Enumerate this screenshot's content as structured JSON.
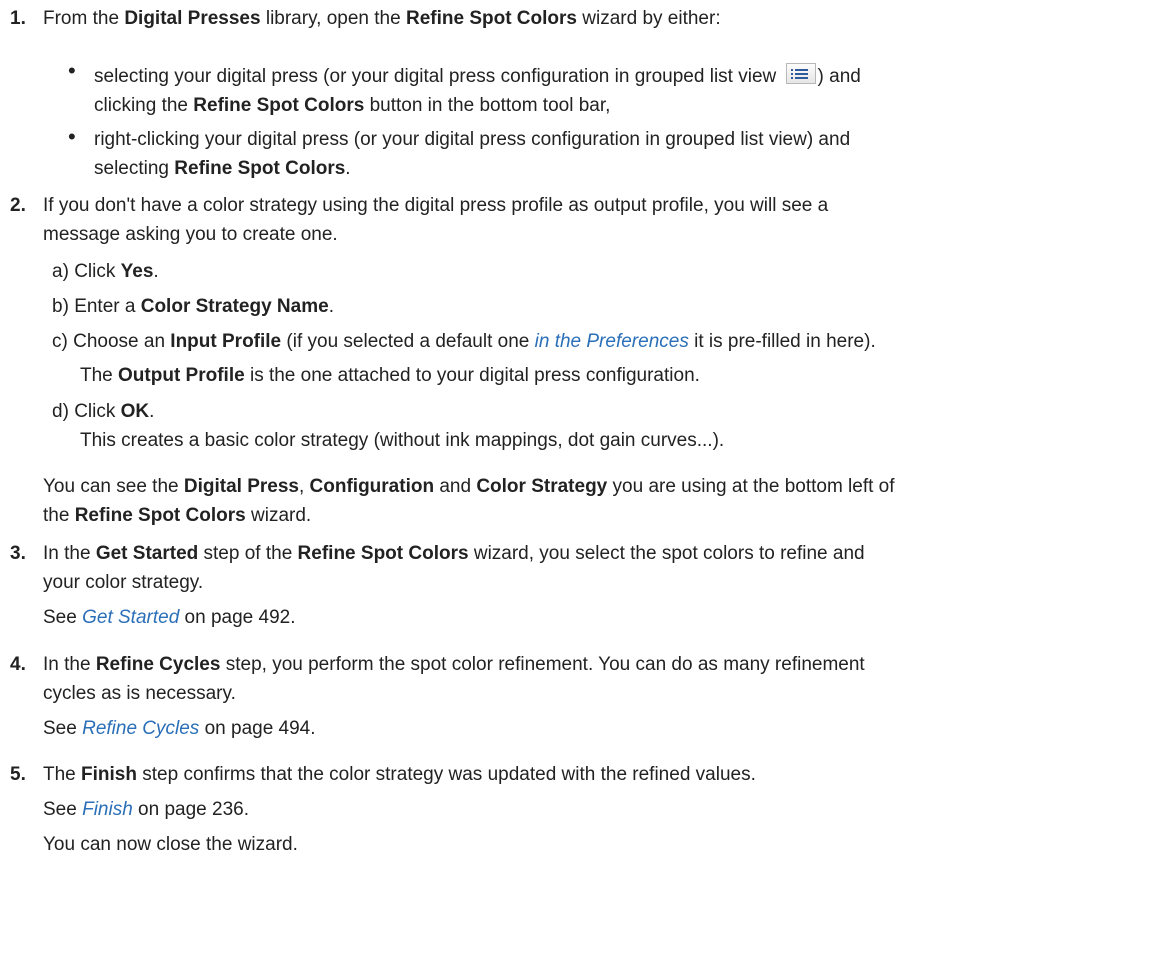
{
  "steps": [
    {
      "num": "1.",
      "line1": [
        "From the ",
        "Digital Presses",
        " library, open the ",
        "Refine Spot Colors",
        " wizard by either:"
      ],
      "bullets": [
        {
          "line1_a": "selecting your digital press (or your digital press configuration in grouped list view ",
          "line1_b": ") and",
          "line2": [
            "clicking the ",
            "Refine Spot Colors",
            " button in the bottom tool bar,"
          ]
        },
        {
          "line1": "right-clicking your digital press (or your digital press configuration in grouped list view) and",
          "line2": [
            "selecting ",
            "Refine Spot Colors",
            "."
          ]
        }
      ]
    },
    {
      "num": "2.",
      "line1": "If you don't have a color strategy using the digital press profile as output profile, you will see a",
      "line2": "message asking you to create one.",
      "sub": {
        "a": [
          "a)",
          "Click ",
          "Yes",
          "."
        ],
        "b": [
          "b)",
          "Enter a ",
          "Color Strategy Name",
          "."
        ],
        "c": [
          "c)",
          "Choose an ",
          "Input Profile",
          " (if you selected a default one ",
          "in the Preferences",
          " it is pre-filled in here)."
        ],
        "c2": [
          "The ",
          "Output Profile",
          " is the one attached to your digital press configuration."
        ],
        "d": [
          "d)",
          "Click ",
          "OK",
          "."
        ],
        "d2": "This creates a basic color strategy (without ink mappings, dot gain curves...)."
      },
      "note1": [
        "You can see the ",
        "Digital Press",
        ", ",
        "Configuration",
        " and ",
        "Color Strategy",
        " you are using at the bottom left of"
      ],
      "note2": [
        "the ",
        "Refine Spot Colors",
        " wizard."
      ]
    },
    {
      "num": "3.",
      "line1": [
        "In the ",
        "Get Started",
        " step of the ",
        "Refine Spot Colors",
        " wizard, you select the spot colors to refine and"
      ],
      "line2": "your color strategy.",
      "see": [
        "See ",
        "Get Started",
        " on page 492."
      ]
    },
    {
      "num": "4.",
      "line1": [
        "In the ",
        "Refine Cycles",
        " step, you perform the spot color refinement. You can do as many refinement"
      ],
      "line2": "cycles as is necessary.",
      "see": [
        "See ",
        "Refine Cycles",
        " on page 494."
      ]
    },
    {
      "num": "5.",
      "line1": [
        "The ",
        "Finish",
        " step confirms that the color strategy was updated with the refined values."
      ],
      "see": [
        "See ",
        "Finish",
        " on page 236."
      ],
      "close": "You can now close the wizard."
    }
  ],
  "icons": {
    "grouped_list_view": "list-view-icon"
  },
  "colors": {
    "link": "#2a6fb8",
    "text": "#222222"
  }
}
